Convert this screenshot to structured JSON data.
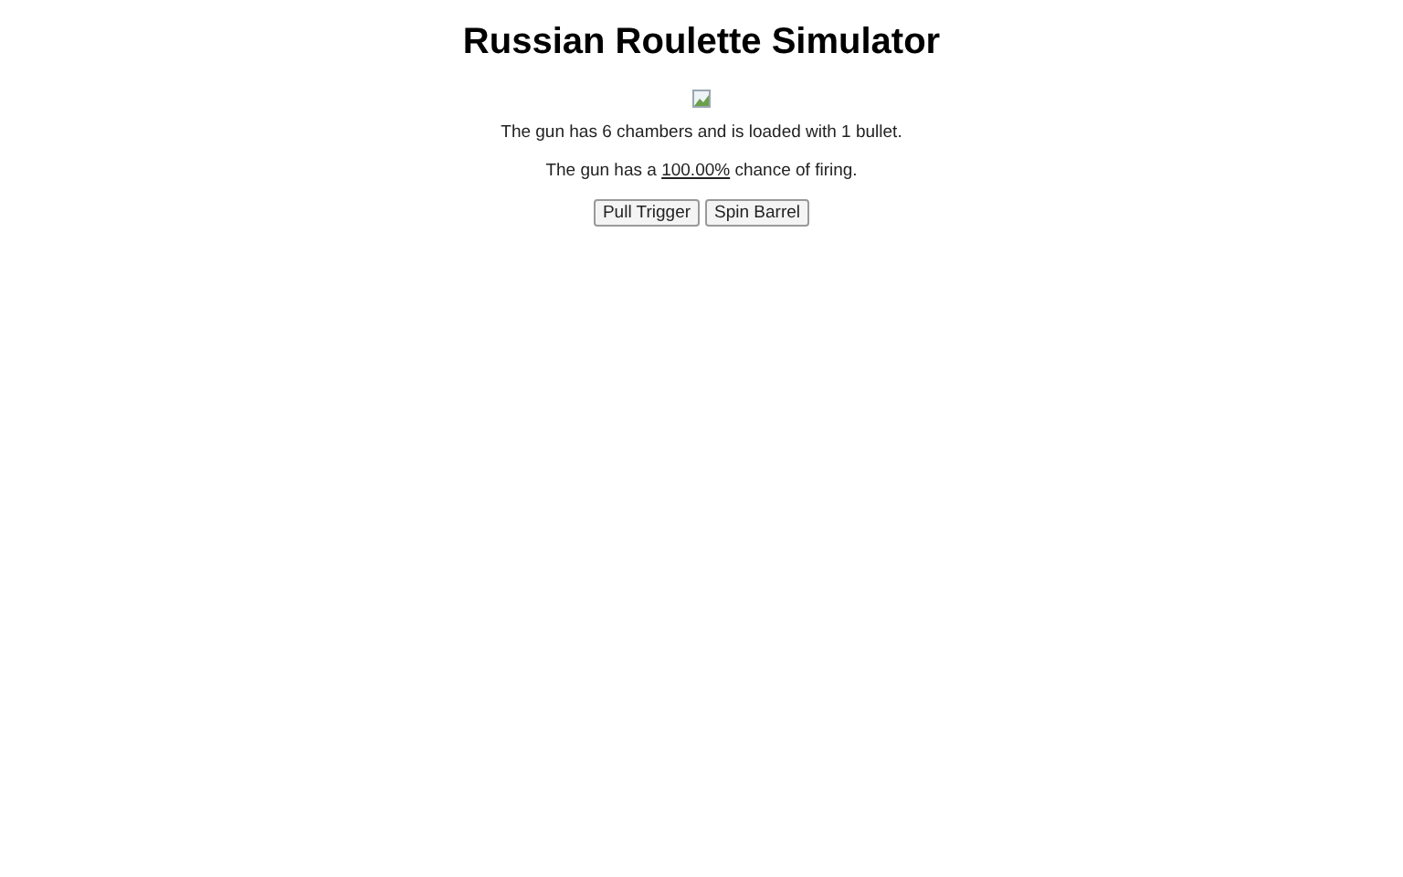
{
  "title": "Russian Roulette Simulator",
  "image": {
    "kind": "broken-image"
  },
  "info": "The gun has 6 chambers and is loaded with 1 bullet.",
  "chance": {
    "before": "The gun has a ",
    "value": "100.00%",
    "after": " chance of firing."
  },
  "buttons": [
    "Pull Trigger",
    "Spin Barrel"
  ]
}
